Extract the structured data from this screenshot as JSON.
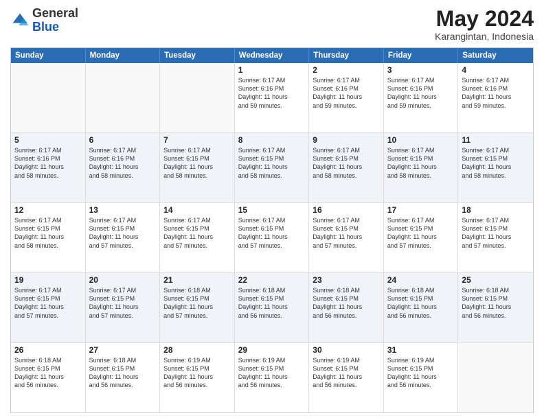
{
  "header": {
    "logo_general": "General",
    "logo_blue": "Blue",
    "title": "May 2024",
    "location": "Karangintan, Indonesia"
  },
  "days_of_week": [
    "Sunday",
    "Monday",
    "Tuesday",
    "Wednesday",
    "Thursday",
    "Friday",
    "Saturday"
  ],
  "rows": [
    {
      "alt": false,
      "cells": [
        {
          "day": "",
          "info": ""
        },
        {
          "day": "",
          "info": ""
        },
        {
          "day": "",
          "info": ""
        },
        {
          "day": "1",
          "info": "Sunrise: 6:17 AM\nSunset: 6:16 PM\nDaylight: 11 hours\nand 59 minutes."
        },
        {
          "day": "2",
          "info": "Sunrise: 6:17 AM\nSunset: 6:16 PM\nDaylight: 11 hours\nand 59 minutes."
        },
        {
          "day": "3",
          "info": "Sunrise: 6:17 AM\nSunset: 6:16 PM\nDaylight: 11 hours\nand 59 minutes."
        },
        {
          "day": "4",
          "info": "Sunrise: 6:17 AM\nSunset: 6:16 PM\nDaylight: 11 hours\nand 59 minutes."
        }
      ]
    },
    {
      "alt": true,
      "cells": [
        {
          "day": "5",
          "info": "Sunrise: 6:17 AM\nSunset: 6:16 PM\nDaylight: 11 hours\nand 58 minutes."
        },
        {
          "day": "6",
          "info": "Sunrise: 6:17 AM\nSunset: 6:16 PM\nDaylight: 11 hours\nand 58 minutes."
        },
        {
          "day": "7",
          "info": "Sunrise: 6:17 AM\nSunset: 6:15 PM\nDaylight: 11 hours\nand 58 minutes."
        },
        {
          "day": "8",
          "info": "Sunrise: 6:17 AM\nSunset: 6:15 PM\nDaylight: 11 hours\nand 58 minutes."
        },
        {
          "day": "9",
          "info": "Sunrise: 6:17 AM\nSunset: 6:15 PM\nDaylight: 11 hours\nand 58 minutes."
        },
        {
          "day": "10",
          "info": "Sunrise: 6:17 AM\nSunset: 6:15 PM\nDaylight: 11 hours\nand 58 minutes."
        },
        {
          "day": "11",
          "info": "Sunrise: 6:17 AM\nSunset: 6:15 PM\nDaylight: 11 hours\nand 58 minutes."
        }
      ]
    },
    {
      "alt": false,
      "cells": [
        {
          "day": "12",
          "info": "Sunrise: 6:17 AM\nSunset: 6:15 PM\nDaylight: 11 hours\nand 58 minutes."
        },
        {
          "day": "13",
          "info": "Sunrise: 6:17 AM\nSunset: 6:15 PM\nDaylight: 11 hours\nand 57 minutes."
        },
        {
          "day": "14",
          "info": "Sunrise: 6:17 AM\nSunset: 6:15 PM\nDaylight: 11 hours\nand 57 minutes."
        },
        {
          "day": "15",
          "info": "Sunrise: 6:17 AM\nSunset: 6:15 PM\nDaylight: 11 hours\nand 57 minutes."
        },
        {
          "day": "16",
          "info": "Sunrise: 6:17 AM\nSunset: 6:15 PM\nDaylight: 11 hours\nand 57 minutes."
        },
        {
          "day": "17",
          "info": "Sunrise: 6:17 AM\nSunset: 6:15 PM\nDaylight: 11 hours\nand 57 minutes."
        },
        {
          "day": "18",
          "info": "Sunrise: 6:17 AM\nSunset: 6:15 PM\nDaylight: 11 hours\nand 57 minutes."
        }
      ]
    },
    {
      "alt": true,
      "cells": [
        {
          "day": "19",
          "info": "Sunrise: 6:17 AM\nSunset: 6:15 PM\nDaylight: 11 hours\nand 57 minutes."
        },
        {
          "day": "20",
          "info": "Sunrise: 6:17 AM\nSunset: 6:15 PM\nDaylight: 11 hours\nand 57 minutes."
        },
        {
          "day": "21",
          "info": "Sunrise: 6:18 AM\nSunset: 6:15 PM\nDaylight: 11 hours\nand 57 minutes."
        },
        {
          "day": "22",
          "info": "Sunrise: 6:18 AM\nSunset: 6:15 PM\nDaylight: 11 hours\nand 56 minutes."
        },
        {
          "day": "23",
          "info": "Sunrise: 6:18 AM\nSunset: 6:15 PM\nDaylight: 11 hours\nand 56 minutes."
        },
        {
          "day": "24",
          "info": "Sunrise: 6:18 AM\nSunset: 6:15 PM\nDaylight: 11 hours\nand 56 minutes."
        },
        {
          "day": "25",
          "info": "Sunrise: 6:18 AM\nSunset: 6:15 PM\nDaylight: 11 hours\nand 56 minutes."
        }
      ]
    },
    {
      "alt": false,
      "cells": [
        {
          "day": "26",
          "info": "Sunrise: 6:18 AM\nSunset: 6:15 PM\nDaylight: 11 hours\nand 56 minutes."
        },
        {
          "day": "27",
          "info": "Sunrise: 6:18 AM\nSunset: 6:15 PM\nDaylight: 11 hours\nand 56 minutes."
        },
        {
          "day": "28",
          "info": "Sunrise: 6:19 AM\nSunset: 6:15 PM\nDaylight: 11 hours\nand 56 minutes."
        },
        {
          "day": "29",
          "info": "Sunrise: 6:19 AM\nSunset: 6:15 PM\nDaylight: 11 hours\nand 56 minutes."
        },
        {
          "day": "30",
          "info": "Sunrise: 6:19 AM\nSunset: 6:15 PM\nDaylight: 11 hours\nand 56 minutes."
        },
        {
          "day": "31",
          "info": "Sunrise: 6:19 AM\nSunset: 6:15 PM\nDaylight: 11 hours\nand 56 minutes."
        },
        {
          "day": "",
          "info": ""
        }
      ]
    }
  ]
}
